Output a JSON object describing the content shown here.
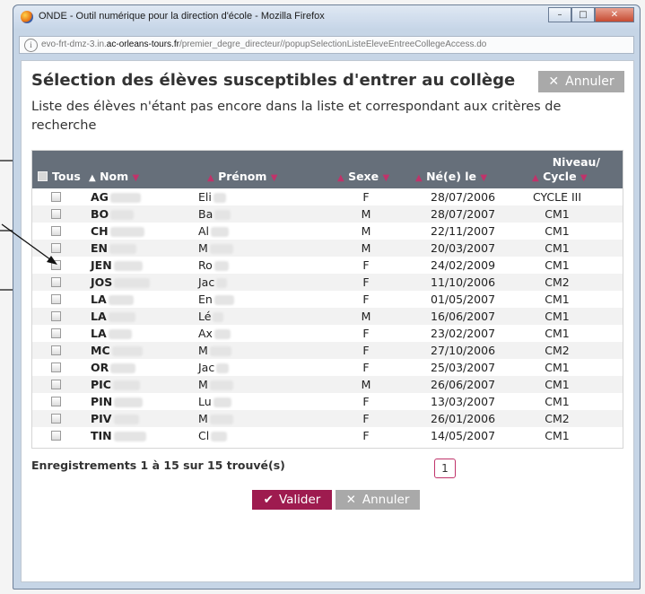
{
  "window": {
    "title": "ONDE - Outil numérique pour la direction d'école - Mozilla Firefox",
    "url_prefix": "evo-frt-dmz-3.in.",
    "url_host": "ac-orleans-tours.fr",
    "url_path": "/premier_degre_directeur//popupSelectionListeEleveEntreeCollegeAccess.do",
    "minimize_icon": "–",
    "maximize_icon": "□",
    "close_icon": "✕"
  },
  "dialog": {
    "title": "Sélection des élèves susceptibles d'entrer au collège",
    "subtitle": "Liste des élèves n'étant pas encore dans la liste et correspondant aux critères de recherche",
    "cancel_top_label": "Annuler",
    "count_text": "Enregistrements 1 à 15 sur 15 trouvé(s)",
    "page_number": "1",
    "validate_label": "Valider",
    "cancel_label": "Annuler"
  },
  "table": {
    "headers": {
      "tous": "Tous",
      "nom": "Nom",
      "prenom": "Prénom",
      "sexe": "Sexe",
      "ne_le": "Né(e) le",
      "niveau_line1": "Niveau/",
      "niveau_line2": "Cycle"
    },
    "rows": [
      {
        "nom": "AG",
        "prenom": "Eli",
        "sexe": "F",
        "date": "28/07/2006",
        "niveau": "CYCLE III"
      },
      {
        "nom": "BO",
        "prenom": "Ba",
        "sexe": "M",
        "date": "28/07/2007",
        "niveau": "CM1"
      },
      {
        "nom": "CH",
        "prenom": "Al",
        "sexe": "M",
        "date": "22/11/2007",
        "niveau": "CM1"
      },
      {
        "nom": "EN",
        "prenom": "M",
        "sexe": "M",
        "date": "20/03/2007",
        "niveau": "CM1"
      },
      {
        "nom": "JEN",
        "prenom": "Ro",
        "sexe": "F",
        "date": "24/02/2009",
        "niveau": "CM1"
      },
      {
        "nom": "JOS",
        "prenom": "Jac",
        "sexe": "F",
        "date": "11/10/2006",
        "niveau": "CM2"
      },
      {
        "nom": "LA",
        "prenom": "En",
        "sexe": "F",
        "date": "01/05/2007",
        "niveau": "CM1"
      },
      {
        "nom": "LA",
        "prenom": "Lé",
        "sexe": "M",
        "date": "16/06/2007",
        "niveau": "CM1"
      },
      {
        "nom": "LA",
        "prenom": "Ax",
        "sexe": "F",
        "date": "23/02/2007",
        "niveau": "CM1"
      },
      {
        "nom": "MC",
        "prenom": "M",
        "sexe": "F",
        "date": "27/10/2006",
        "niveau": "CM2"
      },
      {
        "nom": "OR",
        "prenom": "Jac",
        "sexe": "F",
        "date": "25/03/2007",
        "niveau": "CM1"
      },
      {
        "nom": "PIC",
        "prenom": "M",
        "sexe": "M",
        "date": "26/06/2007",
        "niveau": "CM1"
      },
      {
        "nom": "PIN",
        "prenom": "Lu",
        "sexe": "F",
        "date": "13/03/2007",
        "niveau": "CM1"
      },
      {
        "nom": "PIV",
        "prenom": "M",
        "sexe": "F",
        "date": "26/01/2006",
        "niveau": "CM2"
      },
      {
        "nom": "TIN",
        "prenom": "Cl",
        "sexe": "F",
        "date": "14/05/2007",
        "niveau": "CM1"
      }
    ]
  },
  "colors": {
    "accent": "#9e1b4f",
    "header_bg": "#666f7a",
    "button_grey": "#a9a9a9"
  }
}
